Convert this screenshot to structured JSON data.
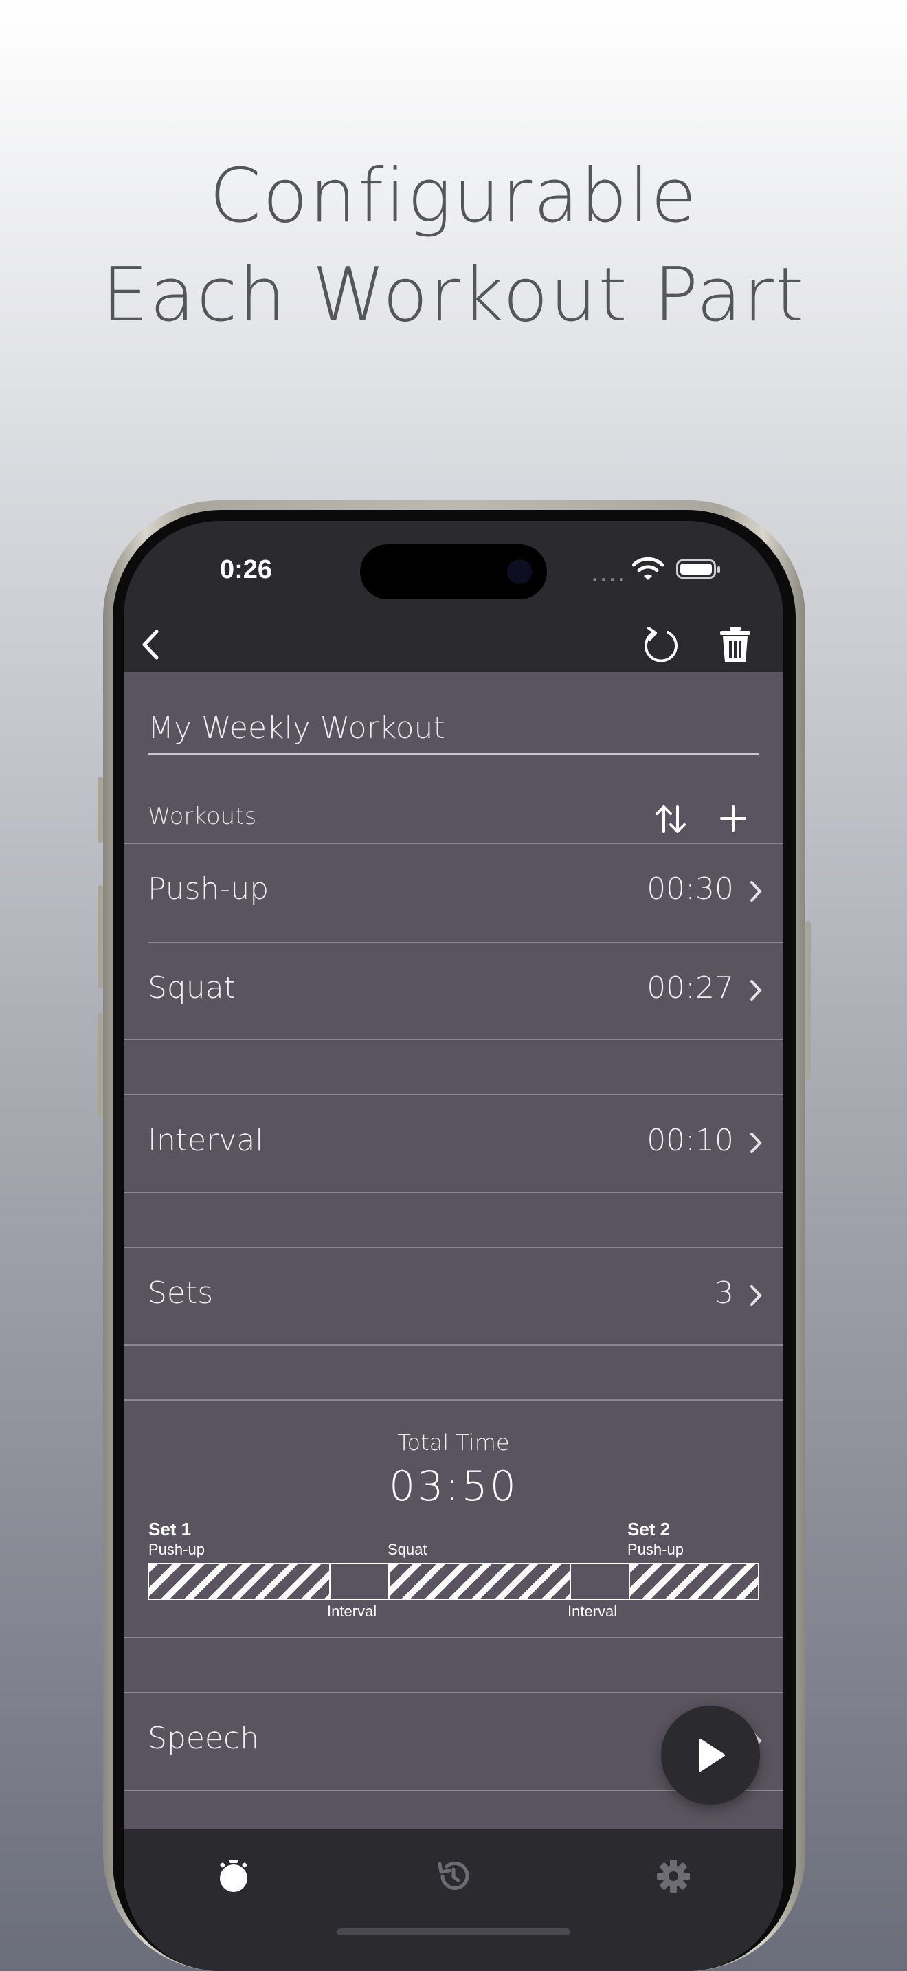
{
  "headline": {
    "line1": "Configurable",
    "line2": "Each Workout Part"
  },
  "status_bar": {
    "time": "0:26"
  },
  "nav": {
    "back": "back-icon",
    "reset": "reset-icon",
    "delete": "trash-icon"
  },
  "workout_name": "My Weekly Workout",
  "workouts_section": {
    "label": "Workouts"
  },
  "workouts": [
    {
      "name": "Push-up",
      "duration": "00:30"
    },
    {
      "name": "Squat",
      "duration": "00:27"
    }
  ],
  "interval": {
    "label": "Interval",
    "value": "00:10"
  },
  "sets": {
    "label": "Sets",
    "value": "3"
  },
  "total": {
    "label": "Total Time",
    "value": "03:50"
  },
  "timeline": {
    "set1": "Set 1",
    "set2": "Set 2",
    "pushup": "Push-up",
    "squat": "Squat",
    "pushup2": "Push-up",
    "interval1": "Interval",
    "interval2": "Interval"
  },
  "speech": {
    "label": "Speech"
  },
  "tabs": [
    "timer-icon",
    "history-icon",
    "settings-icon"
  ],
  "colors": {
    "content_bg": "#59545f",
    "bar_bg": "#2b2a2f",
    "text": "#f1eff3"
  }
}
